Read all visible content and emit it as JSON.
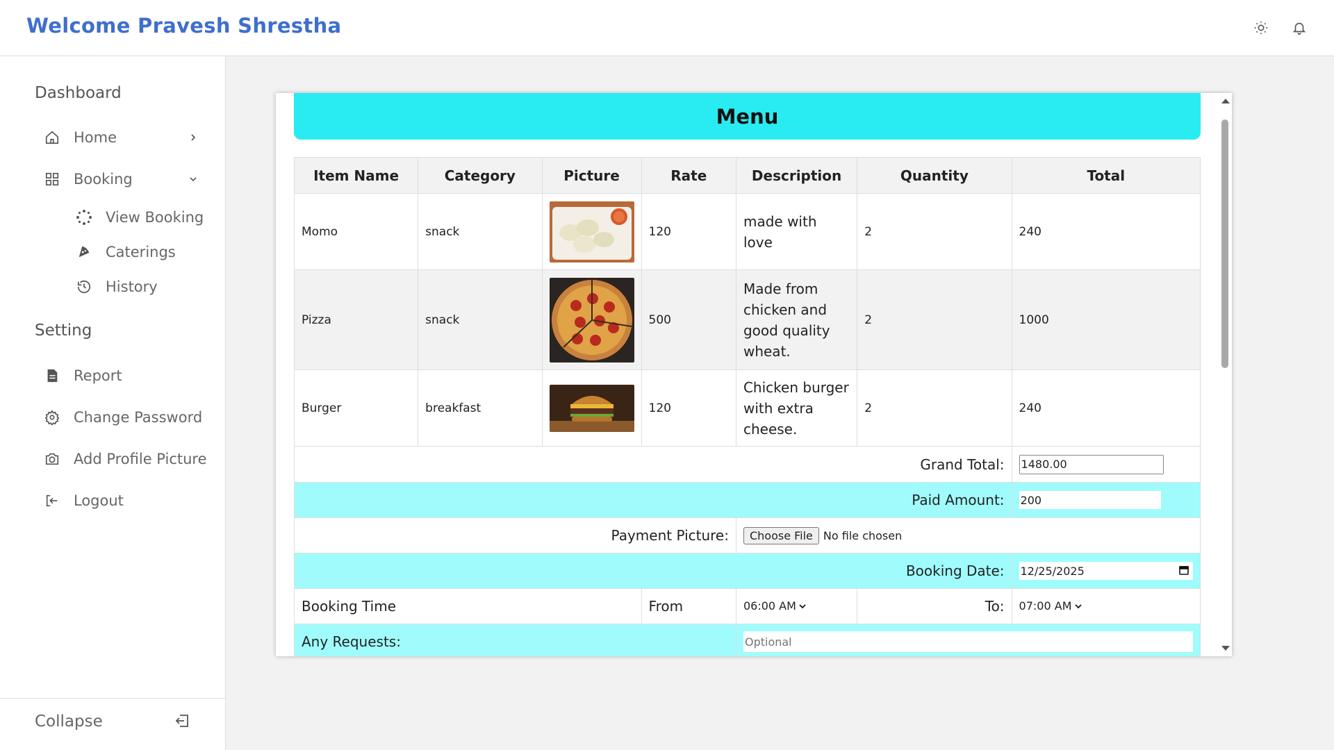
{
  "header": {
    "title": "Welcome Pravesh Shrestha",
    "icons": [
      "sun-icon",
      "bell-icon"
    ]
  },
  "sidebar": {
    "dashboard_heading": "Dashboard",
    "home": "Home",
    "booking": "Booking",
    "view_booking": "View Booking",
    "caterings": "Caterings",
    "history": "History",
    "setting_heading": "Setting",
    "report": "Report",
    "change_password": "Change Password",
    "add_profile_picture": "Add Profile Picture",
    "logout": "Logout",
    "collapse": "Collapse"
  },
  "menu": {
    "title": "Menu",
    "columns": [
      "Item Name",
      "Category",
      "Picture",
      "Rate",
      "Description",
      "Quantity",
      "Total"
    ],
    "items": [
      {
        "name": "Momo",
        "category": "snack",
        "rate": "120",
        "description": "made with love",
        "quantity": "2",
        "total": "240"
      },
      {
        "name": "Pizza",
        "category": "snack",
        "rate": "500",
        "description": "Made from chicken and good quality wheat.",
        "quantity": "2",
        "total": "1000"
      },
      {
        "name": "Burger",
        "category": "breakfast",
        "rate": "120",
        "description": "Chicken burger with extra cheese.",
        "quantity": "2",
        "total": "240"
      }
    ]
  },
  "form": {
    "grand_total_label": "Grand Total:",
    "grand_total_value": "1480.00",
    "paid_amount_label": "Paid Amount:",
    "paid_amount_value": "200",
    "payment_picture_label": "Payment Picture:",
    "choose_file": "Choose File",
    "no_file": "No file chosen",
    "booking_date_label": "Booking Date:",
    "booking_date_value": "12/25/2025",
    "booking_time_label": "Booking Time",
    "from_label": "From",
    "from_value": "06:00 AM",
    "to_label": "To:",
    "to_value": "07:00 AM",
    "requests_label": "Any Requests:",
    "requests_placeholder": "Optional"
  },
  "colors": {
    "brand_title": "#3f6fcc",
    "menu_banner": "#29ecf3",
    "highlight_row": "#a0fcfc"
  }
}
